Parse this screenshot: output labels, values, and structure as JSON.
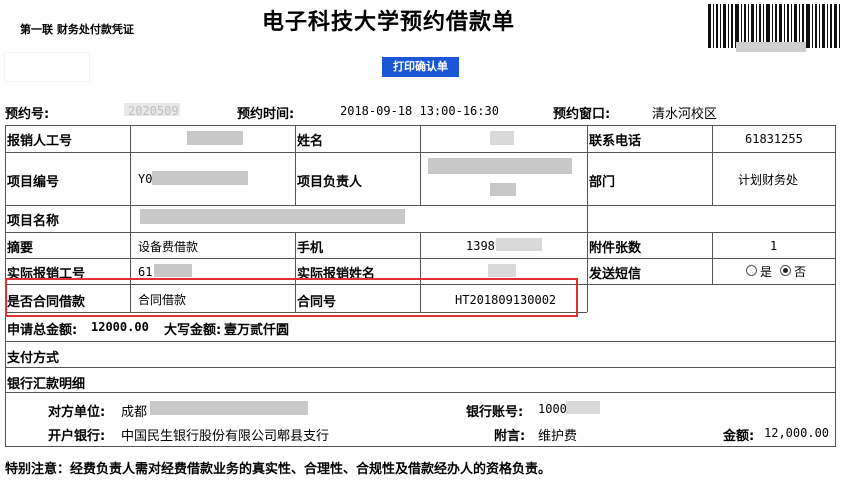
{
  "header": {
    "title": "电子科技大学预约借款单",
    "copy_label": "第一联 财务处付款凭证",
    "print_button": "打印确认单"
  },
  "booking": {
    "number_label": "预约号:",
    "number_value": "2020509",
    "time_label": "预约时间:",
    "time_value": "2018-09-18 13:00-16:30",
    "window_label": "预约窗口:",
    "window_value": "清水河校区"
  },
  "table": {
    "reimburser_label": "报销人工号",
    "name_label": "姓名",
    "phone_label": "联系电话",
    "phone_value": "61831255",
    "project_no_label": "项目编号",
    "project_no_value": "Y0",
    "project_lead_label": "项目负责人",
    "department_label": "部门",
    "department_value": "计划财务处",
    "project_name_label": "项目名称",
    "summary_label": "摘要",
    "summary_value": "设备费借款",
    "mobile_label": "手机",
    "mobile_value": "1398",
    "attachments_label": "附件张数",
    "attachments_value": "1",
    "actual_no_label": "实际报销工号",
    "actual_no_value": "61",
    "actual_name_label": "实际报销姓名",
    "sms_label": "发送短信",
    "sms_yes": "是",
    "sms_no": "否",
    "sms_selected": "否",
    "contract_flag_label": "是否合同借款",
    "contract_flag_value": "合同借款",
    "contract_no_label": "合同号",
    "contract_no_value": "HT201809130002"
  },
  "totals": {
    "total_label": "申请总金额:",
    "total_value": "12000.00",
    "caps_label": "大写金额:",
    "caps_value": "壹万贰仟圆"
  },
  "payment": {
    "method_label": "支付方式",
    "bank_detail_label": "银行汇款明细",
    "counterparty_label": "对方单位:",
    "counterparty_value": "成都",
    "account_label": "银行账号:",
    "account_value": "1000",
    "bank_label": "开户银行:",
    "bank_value": "中国民生银行股份有限公司郫县支行",
    "note_label": "附言:",
    "note_value": "维护费",
    "amount_label": "金额:",
    "amount_value": "12,000.00"
  },
  "footer": {
    "notice": "特别注意：经费负责人需对经费借款业务的真实性、合理性、合规性及借款经办人的资格负责。"
  }
}
